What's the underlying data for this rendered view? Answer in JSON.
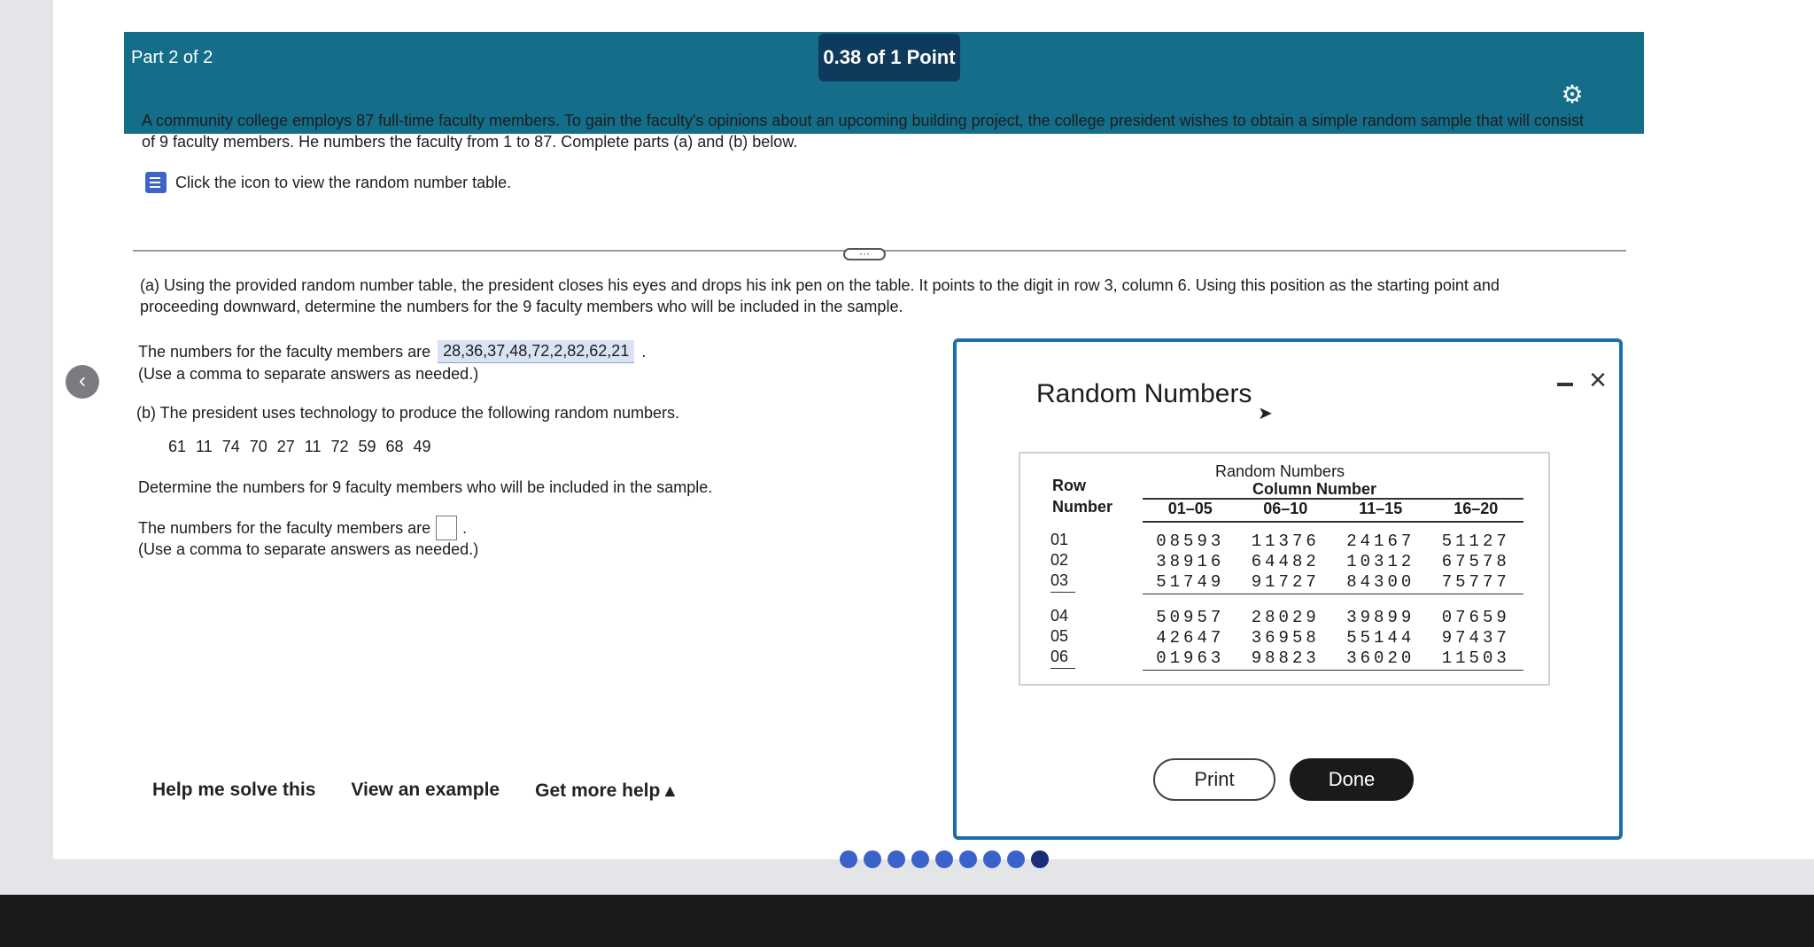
{
  "header": {
    "part_label": "Part 2 of 2",
    "points": "0.38 of 1 Point"
  },
  "question": {
    "text": "A community college employs 87 full-time faculty members. To gain the faculty's opinions about an upcoming building project, the college president wishes to obtain a simple random sample that will consist of 9 faculty members. He numbers the faculty from 1 to 87. Complete parts (a) and (b) below.",
    "icon_link": "Click the icon to view the random number table."
  },
  "part_a": {
    "text": "(a) Using the provided random number table, the president closes his eyes and drops his ink pen on the table. It points to the digit in row 3, column 6. Using this position as the starting point and proceeding downward, determine the numbers for the 9 faculty members who will be included in the sample.",
    "answer_label": "The numbers for the faculty members are",
    "answer_value": "28,36,37,48,72,2,82,62,21",
    "hint": "(Use a comma to separate answers as needed.)"
  },
  "part_b": {
    "text": "(b) The president uses technology to produce the following random numbers.",
    "random_numbers": "61  11  74  70  27  11  72  59  68  49",
    "determine": "Determine the numbers for 9 faculty members who will be included in the sample.",
    "answer_label": "The numbers for the faculty members are",
    "hint": "(Use a comma to separate answers as needed.)"
  },
  "help": {
    "help_me": "Help me solve this",
    "example": "View an example",
    "more_help": "Get more help ▴"
  },
  "dialog": {
    "title": "Random Numbers",
    "table_caption": "Random Numbers",
    "row_header_1": "Row",
    "row_header_2": "Number",
    "column_header": "Column Number",
    "columns": [
      "01–05",
      "06–10",
      "11–15",
      "16–20"
    ],
    "group1": {
      "rows": [
        "01",
        "02",
        "03"
      ],
      "cols": [
        [
          "08593",
          "38916",
          "51749"
        ],
        [
          "11376",
          "64482",
          "91727"
        ],
        [
          "24167",
          "10312",
          "84300"
        ],
        [
          "51127",
          "67578",
          "75777"
        ]
      ]
    },
    "group2": {
      "rows": [
        "04",
        "05",
        "06"
      ],
      "cols": [
        [
          "50957",
          "42647",
          "01963"
        ],
        [
          "28029",
          "36958",
          "98823"
        ],
        [
          "39899",
          "55144",
          "36020"
        ],
        [
          "07659",
          "97437",
          "11503"
        ]
      ]
    },
    "print_label": "Print",
    "done_label": "Done"
  }
}
